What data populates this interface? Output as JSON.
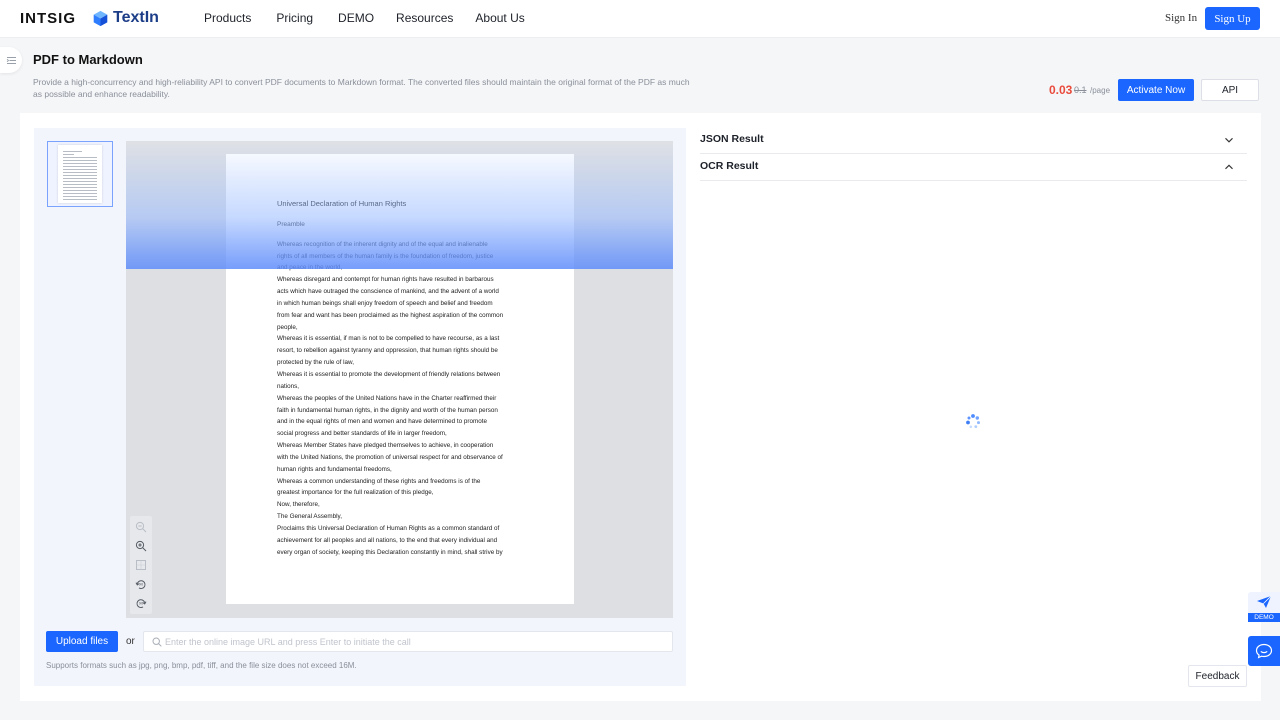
{
  "nav": {
    "brand_intsig": "INTSIG",
    "brand_textin": "TextIn",
    "items": [
      "Products",
      "Pricing",
      "DEMO",
      "Resources",
      "About Us"
    ],
    "sign_in": "Sign In",
    "sign_up": "Sign Up"
  },
  "header": {
    "title": "PDF to Markdown",
    "description": "Provide a high-concurrency and high-reliability API to convert PDF documents to Markdown format. The converted files should maintain the original format of the PDF as much as possible and enhance readability.",
    "price": "0.03",
    "old_price": "0.1",
    "per_page": "/page",
    "activate_label": "Activate Now",
    "api_label": "API"
  },
  "viewer": {
    "doc_title": "Universal Declaration of Human Rights",
    "doc_subtitle": "Preamble",
    "doc_lines": [
      "Whereas recognition of the inherent dignity and of the equal and inalienable",
      "rights of all members of the human family is the foundation of freedom, justice",
      "and peace in the world,",
      "Whereas disregard and contempt for human rights have resulted in barbarous",
      "acts which have outraged the conscience of mankind, and the advent of a world",
      "in which human beings shall enjoy freedom of speech and belief and freedom",
      "from fear and want has been proclaimed as the highest aspiration of the common",
      "people,",
      "Whereas it is essential, if man is not to be compelled to have recourse, as a last",
      "resort, to rebellion against tyranny and oppression, that human rights should be",
      "protected by the rule of law,",
      "Whereas it is essential to promote the development of friendly relations between",
      "nations,",
      "Whereas the peoples of the United Nations have in the Charter reaffirmed their",
      "faith in fundamental human rights, in the dignity and worth of the human person",
      "and in the equal rights of men and women and have determined to promote",
      "social progress and better standards of life in larger freedom,",
      "Whereas Member States have pledged themselves to achieve, in cooperation",
      "with the United Nations, the promotion of universal respect for and observance of",
      "human rights and fundamental freedoms,",
      "Whereas a common understanding of these rights and freedoms is of the",
      "greatest importance for the full realization of this pledge,",
      "Now, therefore,",
      "The General Assembly,",
      "Proclaims this Universal Declaration of Human Rights as a common standard of",
      "achievement for all peoples and all nations, to the end that every individual and",
      "every organ of society, keeping this Declaration constantly in mind, shall strive by"
    ],
    "tools": [
      "zoom-out-icon",
      "zoom-in-icon",
      "fit-page-icon",
      "rotate-left-icon",
      "rotate-right-icon"
    ]
  },
  "upload": {
    "button_label": "Upload files",
    "or_label": "or",
    "url_placeholder": "Enter the online image URL and press Enter to initiate the call",
    "url_value": "",
    "support_text": "Supports formats such as jpg, png, bmp, pdf, tiff, and the file size does not exceed 16M."
  },
  "results": {
    "json_label": "JSON Result",
    "ocr_label": "OCR Result",
    "json_expanded": false,
    "ocr_expanded": true
  },
  "widgets": {
    "demo_label": "DEMO",
    "feedback_label": "Feedback"
  },
  "colors": {
    "primary": "#1a66ff",
    "price": "#e94b3c",
    "brand_dark": "#1c3d87"
  }
}
